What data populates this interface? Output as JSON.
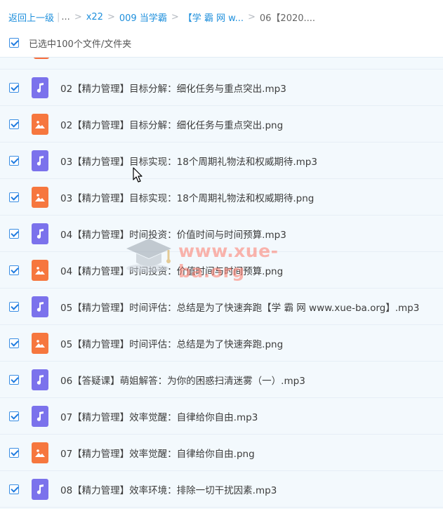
{
  "breadcrumb": {
    "back": "返回上一级",
    "ellipsis": "...",
    "items": [
      "x22",
      "009 当学霸",
      "【学 霸 网 w..."
    ],
    "current": "06【2020...."
  },
  "selection": {
    "text": "已选中100个文件/文件夹",
    "checked": true
  },
  "files": [
    {
      "name": "02【精力管理】目标分解：细化任务与重点突出.mp3",
      "type": "audio",
      "checked": true
    },
    {
      "name": "02【精力管理】目标分解：细化任务与重点突出.png",
      "type": "image",
      "checked": true
    },
    {
      "name": "03【精力管理】目标实现：18个周期礼物法和权威期待.mp3",
      "type": "audio",
      "checked": true
    },
    {
      "name": "03【精力管理】目标实现：18个周期礼物法和权威期待.png",
      "type": "image",
      "checked": true
    },
    {
      "name": "04【精力管理】时间投资：价值时间与时间预算.mp3",
      "type": "audio",
      "checked": true
    },
    {
      "name": "04【精力管理】时间投资：价值时间与时间预算.png",
      "type": "image",
      "checked": true
    },
    {
      "name": "05【精力管理】时间评估：总结是为了快速奔跑【学 霸 网 www.xue-ba.org】.mp3",
      "type": "audio",
      "checked": true
    },
    {
      "name": "05【精力管理】时间评估：总结是为了快速奔跑.png",
      "type": "image",
      "checked": true
    },
    {
      "name": "06【答疑课】萌姐解答：为你的困惑扫清迷雾（一）.mp3",
      "type": "audio",
      "checked": true
    },
    {
      "name": "07【精力管理】效率觉醒：自律给你自由.mp3",
      "type": "audio",
      "checked": true
    },
    {
      "name": "07【精力管理】效率觉醒：自律给你自由.png",
      "type": "image",
      "checked": true
    },
    {
      "name": "08【精力管理】效率环境：排除一切干扰因素.mp3",
      "type": "audio",
      "checked": true
    }
  ],
  "watermark": {
    "text": "www.xue-ba.org"
  },
  "colors": {
    "link": "#1e8fdc",
    "audio_icon": "#7b72ec",
    "image_icon": "#f6773e",
    "row_bg": "#f3f9fd"
  }
}
